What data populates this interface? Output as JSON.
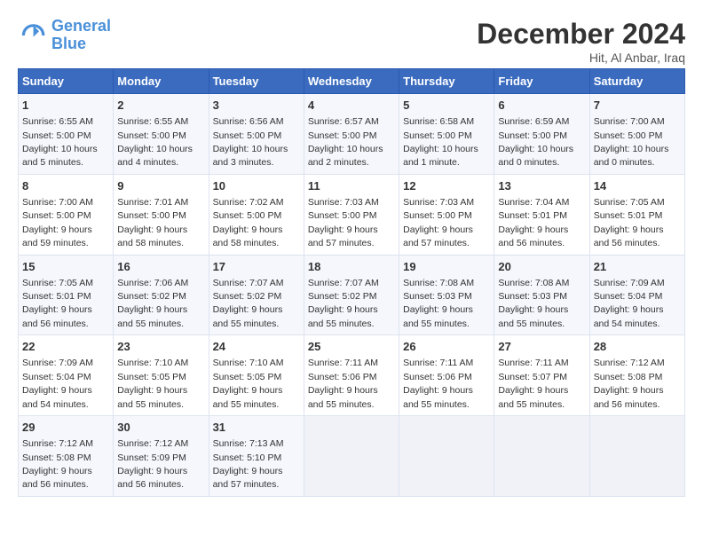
{
  "header": {
    "logo_line1": "General",
    "logo_line2": "Blue",
    "month_title": "December 2024",
    "location": "Hit, Al Anbar, Iraq"
  },
  "weekdays": [
    "Sunday",
    "Monday",
    "Tuesday",
    "Wednesday",
    "Thursday",
    "Friday",
    "Saturday"
  ],
  "weeks": [
    [
      {
        "day": "1",
        "sunrise": "6:55 AM",
        "sunset": "5:00 PM",
        "daylight": "10 hours and 5 minutes."
      },
      {
        "day": "2",
        "sunrise": "6:55 AM",
        "sunset": "5:00 PM",
        "daylight": "10 hours and 4 minutes."
      },
      {
        "day": "3",
        "sunrise": "6:56 AM",
        "sunset": "5:00 PM",
        "daylight": "10 hours and 3 minutes."
      },
      {
        "day": "4",
        "sunrise": "6:57 AM",
        "sunset": "5:00 PM",
        "daylight": "10 hours and 2 minutes."
      },
      {
        "day": "5",
        "sunrise": "6:58 AM",
        "sunset": "5:00 PM",
        "daylight": "10 hours and 1 minute."
      },
      {
        "day": "6",
        "sunrise": "6:59 AM",
        "sunset": "5:00 PM",
        "daylight": "10 hours and 0 minutes."
      },
      {
        "day": "7",
        "sunrise": "7:00 AM",
        "sunset": "5:00 PM",
        "daylight": "10 hours and 0 minutes."
      }
    ],
    [
      {
        "day": "8",
        "sunrise": "7:00 AM",
        "sunset": "5:00 PM",
        "daylight": "9 hours and 59 minutes."
      },
      {
        "day": "9",
        "sunrise": "7:01 AM",
        "sunset": "5:00 PM",
        "daylight": "9 hours and 58 minutes."
      },
      {
        "day": "10",
        "sunrise": "7:02 AM",
        "sunset": "5:00 PM",
        "daylight": "9 hours and 58 minutes."
      },
      {
        "day": "11",
        "sunrise": "7:03 AM",
        "sunset": "5:00 PM",
        "daylight": "9 hours and 57 minutes."
      },
      {
        "day": "12",
        "sunrise": "7:03 AM",
        "sunset": "5:00 PM",
        "daylight": "9 hours and 57 minutes."
      },
      {
        "day": "13",
        "sunrise": "7:04 AM",
        "sunset": "5:01 PM",
        "daylight": "9 hours and 56 minutes."
      },
      {
        "day": "14",
        "sunrise": "7:05 AM",
        "sunset": "5:01 PM",
        "daylight": "9 hours and 56 minutes."
      }
    ],
    [
      {
        "day": "15",
        "sunrise": "7:05 AM",
        "sunset": "5:01 PM",
        "daylight": "9 hours and 56 minutes."
      },
      {
        "day": "16",
        "sunrise": "7:06 AM",
        "sunset": "5:02 PM",
        "daylight": "9 hours and 55 minutes."
      },
      {
        "day": "17",
        "sunrise": "7:07 AM",
        "sunset": "5:02 PM",
        "daylight": "9 hours and 55 minutes."
      },
      {
        "day": "18",
        "sunrise": "7:07 AM",
        "sunset": "5:02 PM",
        "daylight": "9 hours and 55 minutes."
      },
      {
        "day": "19",
        "sunrise": "7:08 AM",
        "sunset": "5:03 PM",
        "daylight": "9 hours and 55 minutes."
      },
      {
        "day": "20",
        "sunrise": "7:08 AM",
        "sunset": "5:03 PM",
        "daylight": "9 hours and 55 minutes."
      },
      {
        "day": "21",
        "sunrise": "7:09 AM",
        "sunset": "5:04 PM",
        "daylight": "9 hours and 54 minutes."
      }
    ],
    [
      {
        "day": "22",
        "sunrise": "7:09 AM",
        "sunset": "5:04 PM",
        "daylight": "9 hours and 54 minutes."
      },
      {
        "day": "23",
        "sunrise": "7:10 AM",
        "sunset": "5:05 PM",
        "daylight": "9 hours and 55 minutes."
      },
      {
        "day": "24",
        "sunrise": "7:10 AM",
        "sunset": "5:05 PM",
        "daylight": "9 hours and 55 minutes."
      },
      {
        "day": "25",
        "sunrise": "7:11 AM",
        "sunset": "5:06 PM",
        "daylight": "9 hours and 55 minutes."
      },
      {
        "day": "26",
        "sunrise": "7:11 AM",
        "sunset": "5:06 PM",
        "daylight": "9 hours and 55 minutes."
      },
      {
        "day": "27",
        "sunrise": "7:11 AM",
        "sunset": "5:07 PM",
        "daylight": "9 hours and 55 minutes."
      },
      {
        "day": "28",
        "sunrise": "7:12 AM",
        "sunset": "5:08 PM",
        "daylight": "9 hours and 56 minutes."
      }
    ],
    [
      {
        "day": "29",
        "sunrise": "7:12 AM",
        "sunset": "5:08 PM",
        "daylight": "9 hours and 56 minutes."
      },
      {
        "day": "30",
        "sunrise": "7:12 AM",
        "sunset": "5:09 PM",
        "daylight": "9 hours and 56 minutes."
      },
      {
        "day": "31",
        "sunrise": "7:13 AM",
        "sunset": "5:10 PM",
        "daylight": "9 hours and 57 minutes."
      },
      null,
      null,
      null,
      null
    ]
  ]
}
